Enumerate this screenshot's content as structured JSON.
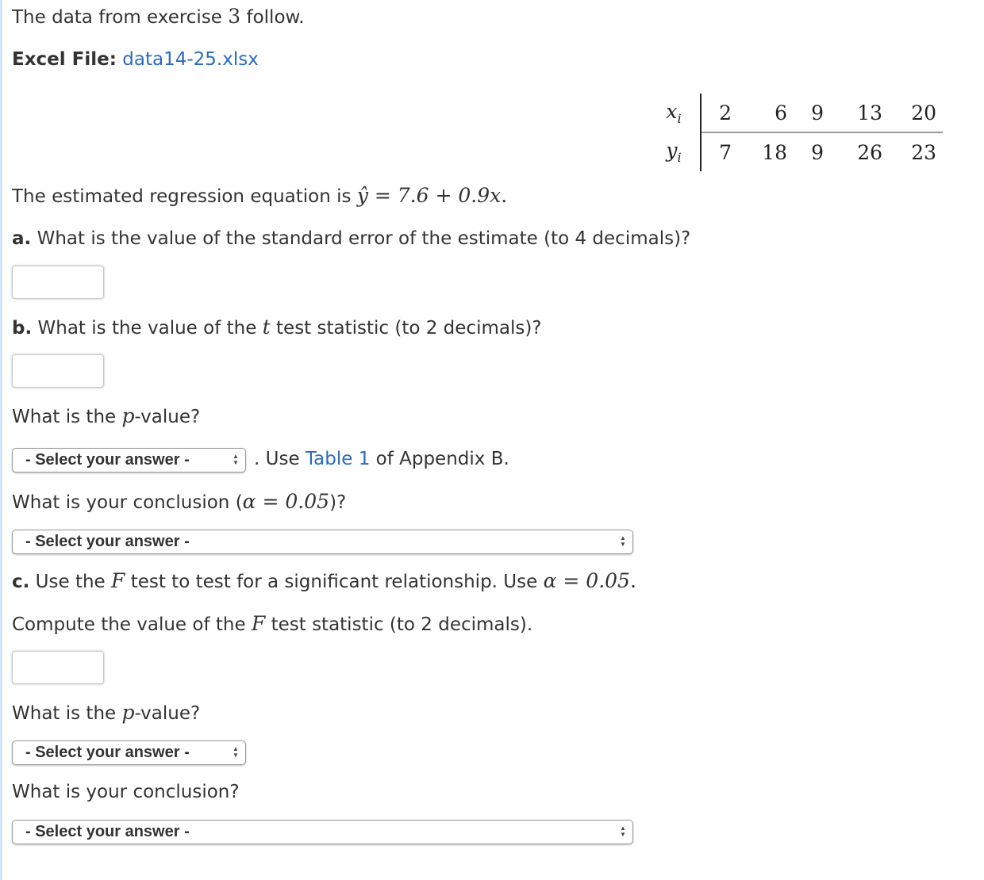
{
  "intro": {
    "text_before": "The data from exercise ",
    "exercise_number": "3",
    "text_after": " follow."
  },
  "excel": {
    "label": "Excel File:",
    "file_link": "data14-25.xlsx"
  },
  "table": {
    "row_labels": [
      "x",
      "y"
    ],
    "subscript": "i",
    "x_values": [
      "2",
      "6",
      "9",
      "13",
      "20"
    ],
    "y_values": [
      "7",
      "18",
      "9",
      "26",
      "23"
    ]
  },
  "regression": {
    "text": "The estimated regression equation is ",
    "equation": "ŷ = 7.6 + 0.9x",
    "period": "."
  },
  "part_a": {
    "label": "a.",
    "question": " What is the value of the standard error of the estimate (to 4 decimals)?",
    "input_value": ""
  },
  "part_b": {
    "label": "b.",
    "question_before": " What is the value of the ",
    "t_symbol": "t",
    "question_after": " test statistic (to 2 decimals)?",
    "input_value": "",
    "p_question_before": "What is the ",
    "p_symbol": "p",
    "p_question_after": "-value?",
    "p_select": "- Select your answer -",
    "p_select_suffix_before": ". Use ",
    "p_select_link": "Table 1",
    "p_select_suffix_after": " of Appendix B.",
    "conclusion_before": "What is your conclusion (",
    "conclusion_alpha": "α = 0.05",
    "conclusion_after": ")?",
    "conclusion_select": "- Select your answer -"
  },
  "part_c": {
    "label": "c.",
    "question_before": " Use the ",
    "f_symbol": "F",
    "question_middle": " test to test for a significant relationship. Use ",
    "alpha": "α = 0.05",
    "question_after": ".",
    "compute_before": "Compute the value of the ",
    "compute_after": " test statistic (to 2 decimals).",
    "input_value": "",
    "p_question_before": "What is the ",
    "p_symbol": "p",
    "p_question_after": "-value?",
    "p_select": "- Select your answer -",
    "conclusion": "What is your conclusion?",
    "conclusion_select": "- Select your answer -"
  },
  "colors": {
    "link": "#2a6bbf",
    "text": "#333333",
    "left_rule": "#d4e4f7"
  }
}
